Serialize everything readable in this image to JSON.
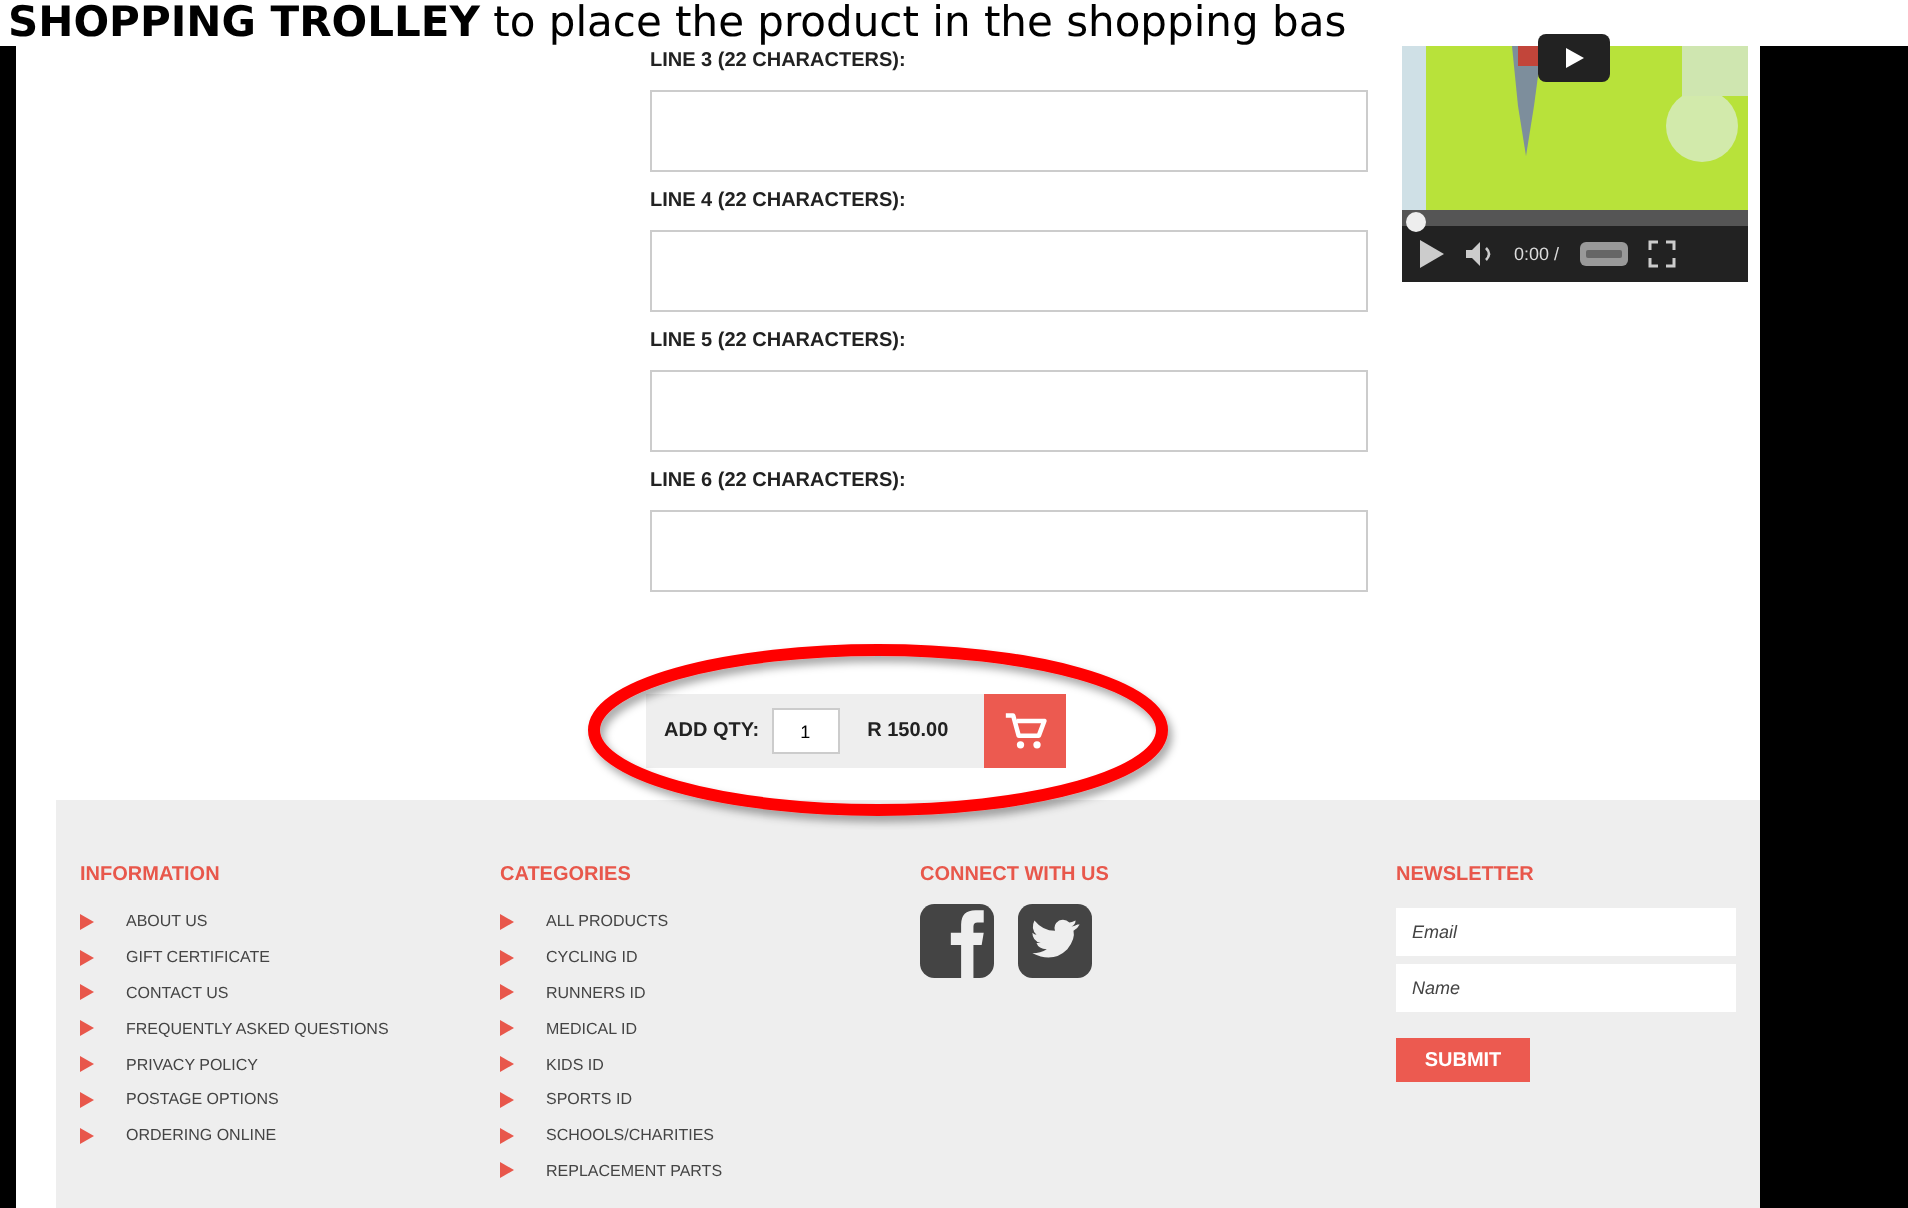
{
  "caption": "**SHOPPING TROLLEY** to place the product in the shopping bas",
  "engraving_lines": [
    {
      "label": "LINE 3 (22 CHARACTERS):"
    },
    {
      "label": "LINE 4 (22 CHARACTERS):"
    },
    {
      "label": "LINE 5 (22 CHARACTERS):"
    },
    {
      "label": "LINE 6 (22 CHARACTERS):"
    }
  ],
  "video": {
    "kind": "picture",
    "time": "0:00 /"
  },
  "add_to_cart": {
    "label": "ADD QTY:",
    "quantity": "1",
    "price": "R 150.00"
  },
  "footer": {
    "information": {
      "title": "INFORMATION",
      "items": [
        "ABOUT US",
        "GIFT CERTIFICATE",
        "CONTACT US",
        "FREQUENTLY ASKED QUESTIONS",
        "PRIVACY POLICY",
        "POSTAGE OPTIONS",
        "ORDERING ONLINE"
      ]
    },
    "categories": {
      "title": "CATEGORIES",
      "items": [
        "ALL PRODUCTS",
        "CYCLING ID",
        "RUNNERS ID",
        "MEDICAL ID",
        "KIDS ID",
        "SPORTS ID",
        "SCHOOLS/CHARITIES",
        "REPLACEMENT PARTS"
      ]
    },
    "connect": {
      "title": "CONNECT WITH US"
    },
    "newsletter": {
      "title": "NEWSLETTER",
      "email_placeholder": "Email",
      "name_placeholder": "Name",
      "submit": "SUBMIT"
    }
  }
}
